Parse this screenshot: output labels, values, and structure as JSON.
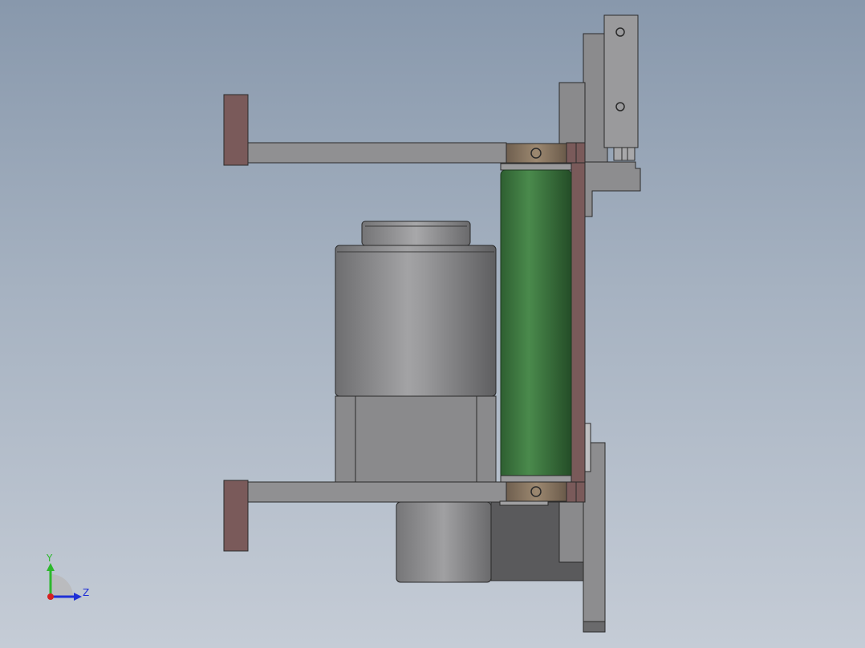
{
  "triad": {
    "y_label": "Y",
    "z_label": "Z",
    "y_color": "#2db82d",
    "z_color": "#1f2fd6",
    "x_color": "#d62020"
  },
  "colors": {
    "background_top": "#8898ac",
    "background_bottom": "#c5ccd6",
    "roller_green": "#3c7a3f",
    "bracket_brown": "#7a5a5a",
    "collar_bronze": "#8a7560",
    "steel_grey": "#8d8d8f",
    "dark_grey": "#5a5a5c",
    "outline": "#2a2a2a"
  }
}
